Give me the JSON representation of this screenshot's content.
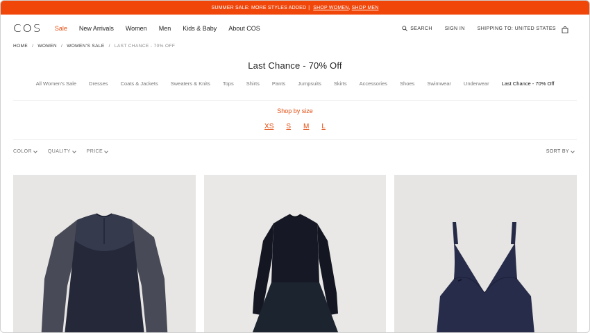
{
  "promo": {
    "text": "Summer sale: more styles added",
    "separator": "|",
    "link_women": "Shop women",
    "link_men": "Shop men"
  },
  "nav": {
    "logo": "COS",
    "items": [
      "Sale",
      "New Arrivals",
      "Women",
      "Men",
      "Kids & Baby",
      "About COS"
    ],
    "search": "Search",
    "signin": "Sign in",
    "shipping": "Shipping to: United States"
  },
  "breadcrumb": {
    "items": [
      "Home",
      "Women",
      "Women's Sale",
      "Last Chance - 70% Off"
    ],
    "separator": "/"
  },
  "page_title": "Last Chance - 70% Off",
  "categories": [
    "All Women's Sale",
    "Dresses",
    "Coats & Jackets",
    "Sweaters & Knits",
    "Tops",
    "Shirts",
    "Pants",
    "Jumpsuits",
    "Skirts",
    "Accessories",
    "Shoes",
    "Swimwear",
    "Underwear",
    "Last Chance - 70% Off"
  ],
  "active_category": "Last Chance - 70% Off",
  "shop_by_size": {
    "label": "Shop by size",
    "sizes": [
      "XS",
      "S",
      "M",
      "L"
    ]
  },
  "filters": {
    "color": "Color",
    "quality": "Quality",
    "price": "Price",
    "sort": "Sort by"
  },
  "colors": {
    "accent": "#e2490b",
    "promo_bg": "#f0460a"
  },
  "products": [
    {
      "icon": "sheer-long-sleeve-dress-image"
    },
    {
      "icon": "knit-flared-dress-image"
    },
    {
      "icon": "v-neck-slip-dress-image"
    }
  ]
}
